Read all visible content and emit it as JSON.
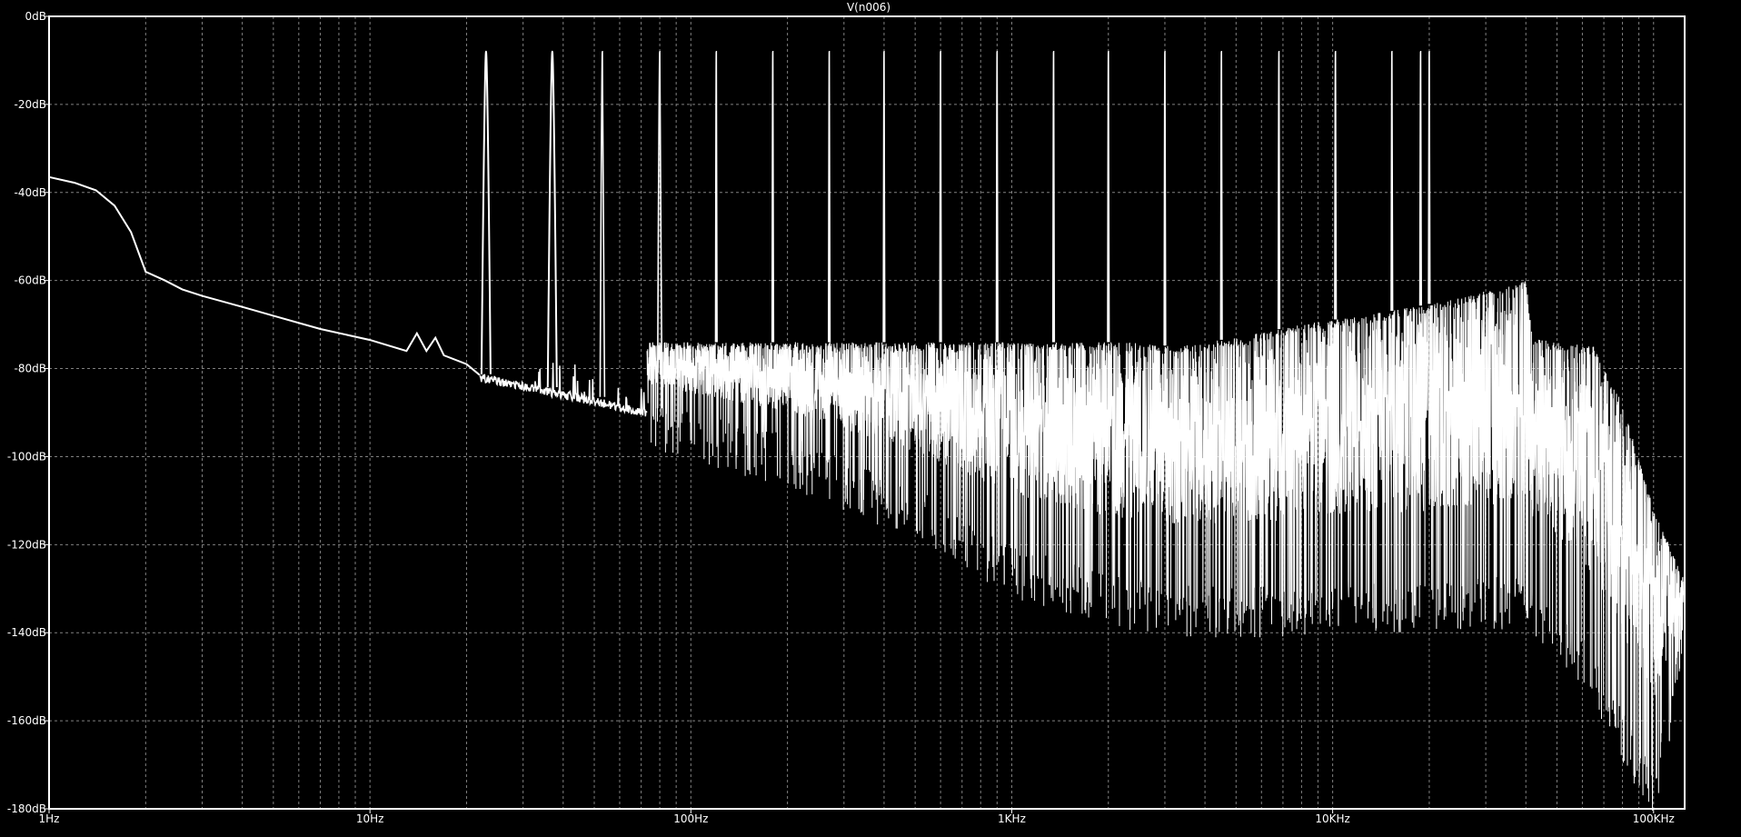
{
  "window": {
    "title": "V(n006)"
  },
  "colors": {
    "background": "#000000",
    "foreground": "#ffffff",
    "grid": "#808080"
  },
  "chart_data": {
    "type": "line",
    "title": "V(n006)",
    "x_scale": "log",
    "xlim_hz": [
      1,
      125000
    ],
    "ylim_db": [
      -180,
      0
    ],
    "grid": true,
    "x_ticks": [
      {
        "value": 1,
        "label": "1Hz"
      },
      {
        "value": 10,
        "label": "10Hz"
      },
      {
        "value": 100,
        "label": "100Hz"
      },
      {
        "value": 1000,
        "label": "1KHz"
      },
      {
        "value": 10000,
        "label": "10KHz"
      },
      {
        "value": 100000,
        "label": "100KHz"
      }
    ],
    "y_ticks": [
      {
        "value": 0,
        "label": "0dB"
      },
      {
        "value": -20,
        "label": "-20dB"
      },
      {
        "value": -40,
        "label": "-40dB"
      },
      {
        "value": -60,
        "label": "-60dB"
      },
      {
        "value": -80,
        "label": "-80dB"
      },
      {
        "value": -100,
        "label": "-100dB"
      },
      {
        "value": -120,
        "label": "-120dB"
      },
      {
        "value": -140,
        "label": "-140dB"
      },
      {
        "value": -160,
        "label": "-160dB"
      },
      {
        "value": -180,
        "label": "-180dB"
      }
    ],
    "series": [
      {
        "name": "V(n006)",
        "low_freq_curve": [
          [
            1,
            -36.5
          ],
          [
            1.2,
            -37.8
          ],
          [
            1.4,
            -39.5
          ],
          [
            1.6,
            -43
          ],
          [
            1.8,
            -49
          ],
          [
            2.0,
            -58
          ],
          [
            2.3,
            -60
          ],
          [
            2.6,
            -62
          ],
          [
            3.0,
            -63.5
          ],
          [
            4,
            -66
          ],
          [
            5,
            -68
          ],
          [
            7,
            -71
          ],
          [
            10,
            -73.5
          ],
          [
            13,
            -76
          ],
          [
            14,
            -72
          ],
          [
            15,
            -76
          ],
          [
            16,
            -73
          ],
          [
            17,
            -77
          ],
          [
            20,
            -79
          ],
          [
            22,
            -81.5
          ]
        ],
        "harmonic_peaks": [
          [
            23,
            -8
          ],
          [
            37,
            -8
          ],
          [
            53,
            -8
          ],
          [
            80,
            -8
          ],
          [
            120,
            -8
          ],
          [
            180,
            -8
          ],
          [
            270,
            -8
          ],
          [
            400,
            -8
          ],
          [
            600,
            -8
          ],
          [
            900,
            -8
          ],
          [
            1350,
            -8
          ],
          [
            2000,
            -8
          ],
          [
            3000,
            -8
          ],
          [
            4500,
            -8
          ],
          [
            6800,
            -8
          ],
          [
            10200,
            -8
          ],
          [
            15300,
            -8
          ],
          [
            18800,
            -8
          ],
          [
            20000,
            -8
          ]
        ],
        "noise_ceiling": [
          [
            73,
            -74
          ],
          [
            2500,
            -74
          ],
          [
            3200,
            -75
          ],
          [
            5000,
            -73
          ],
          [
            8000,
            -70
          ],
          [
            15000,
            -67
          ],
          [
            25000,
            -64
          ],
          [
            35000,
            -61
          ],
          [
            40000,
            -60
          ],
          [
            42000,
            -73
          ],
          [
            50000,
            -74
          ],
          [
            65000,
            -75
          ],
          [
            80000,
            -88
          ],
          [
            100000,
            -112
          ],
          [
            125000,
            -128
          ]
        ],
        "noise_floor": [
          [
            73,
            -87
          ],
          [
            200,
            -95
          ],
          [
            500,
            -107
          ],
          [
            1000,
            -120
          ],
          [
            2000,
            -127
          ],
          [
            5000,
            -130
          ],
          [
            10000,
            -128
          ],
          [
            20000,
            -128
          ],
          [
            40000,
            -127
          ],
          [
            60000,
            -140
          ],
          [
            80000,
            -158
          ],
          [
            100000,
            -170
          ],
          [
            125000,
            -136
          ]
        ]
      }
    ]
  }
}
